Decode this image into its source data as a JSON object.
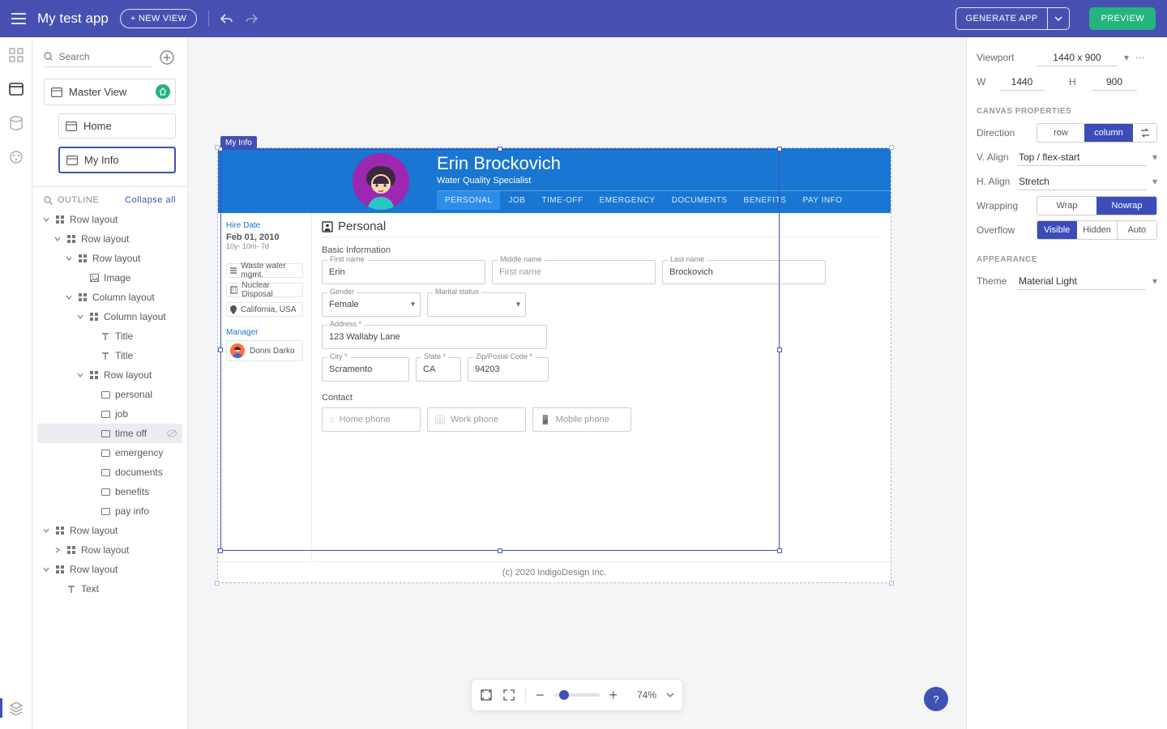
{
  "topbar": {
    "title": "My test app",
    "new_view": "+ NEW VIEW",
    "generate": "GENERATE APP",
    "preview": "PREVIEW"
  },
  "views": {
    "search_placeholder": "Search",
    "master": "Master View",
    "children": [
      "Home",
      "My Info"
    ]
  },
  "outline": {
    "header": "OUTLINE",
    "collapse": "Collapse all",
    "items": [
      {
        "d": 0,
        "tw": "v",
        "ico": "grid",
        "label": "Row layout"
      },
      {
        "d": 1,
        "tw": "v",
        "ico": "grid",
        "label": "Row layout"
      },
      {
        "d": 2,
        "tw": "v",
        "ico": "grid",
        "label": "Row layout"
      },
      {
        "d": 3,
        "tw": "",
        "ico": "img",
        "label": "Image"
      },
      {
        "d": 2,
        "tw": "v",
        "ico": "grid",
        "label": "Column layout"
      },
      {
        "d": 3,
        "tw": "v",
        "ico": "grid",
        "label": "Column layout"
      },
      {
        "d": 4,
        "tw": "",
        "ico": "text",
        "label": "Title"
      },
      {
        "d": 4,
        "tw": "",
        "ico": "text",
        "label": "Title"
      },
      {
        "d": 3,
        "tw": "v",
        "ico": "grid",
        "label": "Row layout"
      },
      {
        "d": 4,
        "tw": "",
        "ico": "card",
        "label": "personal"
      },
      {
        "d": 4,
        "tw": "",
        "ico": "card",
        "label": "job"
      },
      {
        "d": 4,
        "tw": "",
        "ico": "card",
        "label": "time off",
        "hover": true,
        "vis": true
      },
      {
        "d": 4,
        "tw": "",
        "ico": "card",
        "label": "emergency"
      },
      {
        "d": 4,
        "tw": "",
        "ico": "card",
        "label": "documents"
      },
      {
        "d": 4,
        "tw": "",
        "ico": "card",
        "label": "benefits"
      },
      {
        "d": 4,
        "tw": "",
        "ico": "card",
        "label": "pay info"
      },
      {
        "d": 0,
        "tw": "v",
        "ico": "grid",
        "label": "Row layout"
      },
      {
        "d": 1,
        "tw": ">",
        "ico": "grid",
        "label": "Row layout"
      },
      {
        "d": 0,
        "tw": "v",
        "ico": "grid",
        "label": "Row layout"
      },
      {
        "d": 1,
        "tw": "",
        "ico": "text",
        "label": "Text"
      }
    ]
  },
  "canvas": {
    "sel_label": "My Info",
    "footer": "(c) 2020 IndigoDesign Inc.",
    "header": {
      "name": "Erin Brockovich",
      "role": "Water Quality Specialist",
      "tabs": [
        "PERSONAL",
        "JOB",
        "TIME-OFF",
        "EMERGENCY",
        "DOCUMENTS",
        "BENEFITS",
        "PAY INFO"
      ]
    },
    "sidebar": {
      "hire_date_lbl": "Hire Date",
      "hire_date": "Feb 01, 2010",
      "hire_dur": "10y- 10m- 7d",
      "chips": [
        "Waste water mgmt.",
        "Nuclear Disposal",
        "California, USA"
      ],
      "manager_lbl": "Manager",
      "manager": "Donni Darko"
    },
    "form": {
      "title": "Personal",
      "basic": "Basic Information",
      "first": {
        "label": "First name",
        "value": "Erin"
      },
      "middle": {
        "label": "Middle name",
        "value": "First name"
      },
      "last": {
        "label": "Last name",
        "value": "Brockovich"
      },
      "gender": {
        "label": "Gender",
        "value": "Female"
      },
      "marital": {
        "label": "Marital status",
        "value": ""
      },
      "address": {
        "label": "Address *",
        "value": "123 Wallaby Lane"
      },
      "city": {
        "label": "City *",
        "value": "Scramento"
      },
      "state": {
        "label": "State *",
        "value": "CA"
      },
      "zip": {
        "label": "Zip/Postal Code *",
        "value": "94203"
      },
      "contact": "Contact",
      "home": {
        "label": "Home phone"
      },
      "work": {
        "label": "Work phone"
      },
      "mobile": {
        "label": "Mobile phone"
      }
    }
  },
  "zoom": {
    "value": "74%"
  },
  "props": {
    "viewport_lbl": "Viewport",
    "viewport": "1440 x 900",
    "w_lbl": "W",
    "w": "1440",
    "h_lbl": "H",
    "h": "900",
    "canvas_section": "CANVAS PROPERTIES",
    "direction_lbl": "Direction",
    "dir_row": "row",
    "dir_col": "column",
    "valign_lbl": "V. Align",
    "valign": "Top / flex-start",
    "halign_lbl": "H. Align",
    "halign": "Stretch",
    "wrap_lbl": "Wrapping",
    "wrap": "Wrap",
    "nowrap": "Nowrap",
    "overflow_lbl": "Overflow",
    "ov_vis": "Visible",
    "ov_hid": "Hidden",
    "ov_auto": "Auto",
    "appearance_section": "APPEARANCE",
    "theme_lbl": "Theme",
    "theme": "Material Light"
  }
}
